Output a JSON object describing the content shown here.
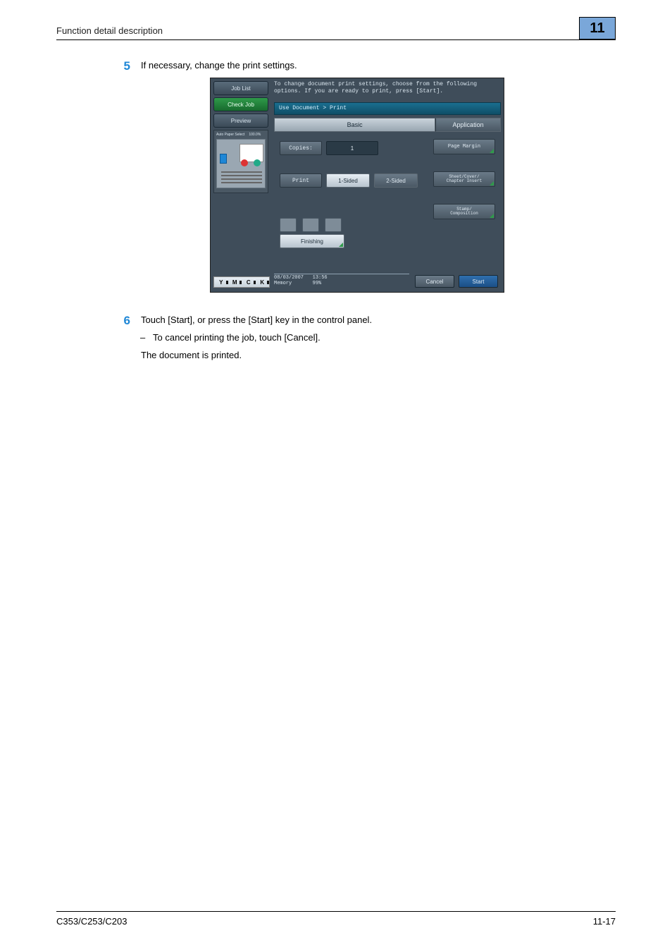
{
  "header": {
    "title": "Function detail description"
  },
  "chapter": "11",
  "steps": {
    "s5": {
      "num": "5",
      "text": "If necessary, change the print settings."
    },
    "s6": {
      "num": "6",
      "text": "Touch [Start], or press the [Start] key in the control panel.",
      "dash": "To cancel printing the job, touch [Cancel].",
      "result": "The document is printed."
    }
  },
  "panel": {
    "side": {
      "job_list": "Job List",
      "check_job": "Check Job",
      "preview": "Preview",
      "auto_paper": "Auto Paper Select",
      "zoom": "100.0%"
    },
    "message_l1": "To change document print settings, choose from the following",
    "message_l2": "options. If you are ready to print, press [Start].",
    "breadcrumb": "Use Document > Print",
    "tabs": {
      "basic": "Basic",
      "application": "Application"
    },
    "basic": {
      "copies_label": "Copies:",
      "copies_value": "1",
      "print_label": "Print",
      "one_sided": "1-Sided",
      "two_sided": "2-Sided",
      "finishing": "Finishing"
    },
    "app_buttons": {
      "page_margin": "Page Margin",
      "sheet_cover": "Sheet/Cover/\nChapter Insert",
      "stamp": "Stamp/\nComposition"
    },
    "status": {
      "date": "08/03/2007",
      "time": "13:56",
      "memory_label": "Memory",
      "memory_value": "99%",
      "cancel": "Cancel",
      "start": "Start",
      "toner": [
        "Y",
        "M",
        "C",
        "K"
      ]
    }
  },
  "footer": {
    "left": "C353/C253/C203",
    "right": "11-17"
  }
}
